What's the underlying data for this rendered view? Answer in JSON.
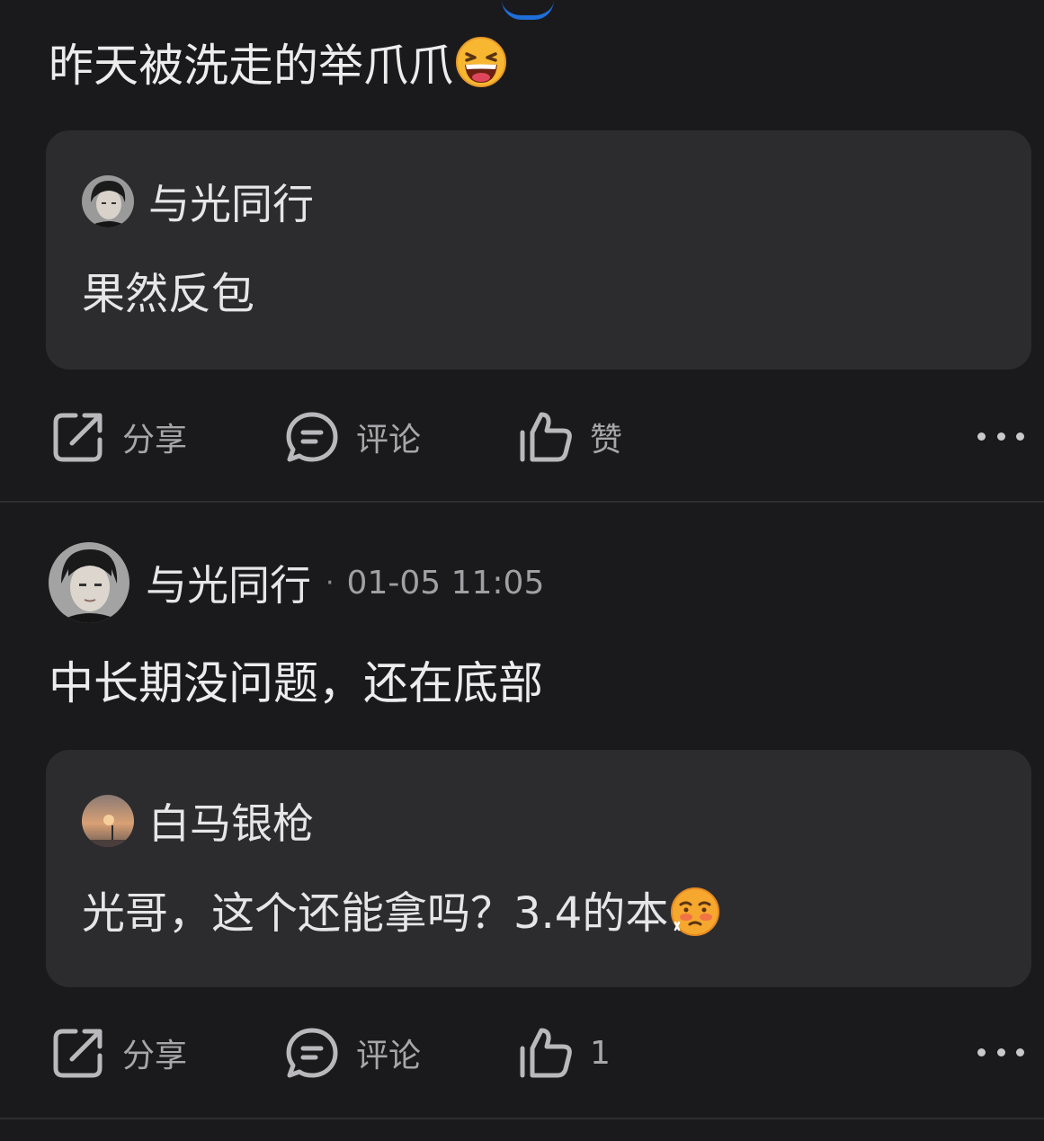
{
  "post1": {
    "text": "昨天被洗走的举爪爪",
    "emoji": "laughing-face-emoji",
    "quote": {
      "author": "与光同行",
      "text": "果然反包"
    },
    "actions": {
      "share": "分享",
      "comment": "评论",
      "like": "赞"
    }
  },
  "post2": {
    "author": "与光同行",
    "separator": "·",
    "timestamp": "01-05 11:05",
    "text": "中长期没问题，还在底部",
    "quote": {
      "author": "白马银枪",
      "text": "光哥，这个还能拿吗？3.4的本",
      "emoji": "flushed-sweat-face-emoji"
    },
    "actions": {
      "share": "分享",
      "comment": "评论",
      "like_count": "1"
    }
  },
  "colors": {
    "background": "#1a1a1c",
    "card": "#2c2c2f",
    "text": "#ececed",
    "muted": "#a7a7ab",
    "accent": "#1e6fd9"
  }
}
